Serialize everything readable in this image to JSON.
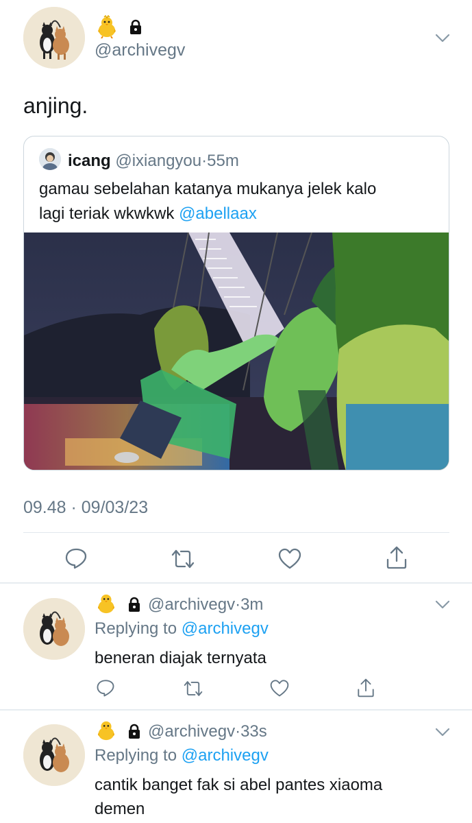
{
  "main_tweet": {
    "handle": "@archivegv",
    "text": "anjing.",
    "timestamp": "09.48 · 09/03/23"
  },
  "quoted_tweet": {
    "name": "icang",
    "handle": "@ixiangyou",
    "dot": "·",
    "time": "55m",
    "text_line1": "gamau sebelahan katanya mukanya jelek kalo",
    "text_line2_prefix": "lagi teriak wkwkwk",
    "mention": "@abellaax"
  },
  "replies": [
    {
      "handle": "@archivegv",
      "dot": "·",
      "time": "3m",
      "replying_label": "Replying to",
      "replying_handle": "@archivegv",
      "text_line1": "beneran diajak ternyata",
      "text_line2": ""
    },
    {
      "handle": "@archivegv",
      "dot": "·",
      "time": "33s",
      "replying_label": "Replying to",
      "replying_handle": "@archivegv",
      "text_line1": "cantik banget fak si abel pantes xiaoma",
      "text_line2": "demen"
    }
  ],
  "icons": [
    "chick-emoji-icon",
    "lock-icon",
    "chevron-down-icon",
    "reply-icon",
    "retweet-icon",
    "like-icon",
    "share-icon"
  ],
  "colors": {
    "link": "#1da1f2",
    "muted": "#657786",
    "text": "#14171a"
  }
}
